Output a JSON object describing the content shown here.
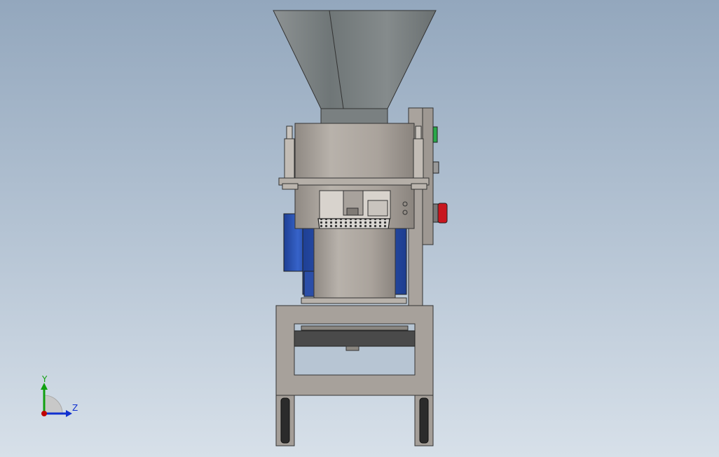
{
  "viewport": {
    "background_top": "#93a7bd",
    "background_bottom": "#d7e0e9"
  },
  "model": {
    "hopper_color": "#7d8486",
    "steel_color": "#a8a29c",
    "motor_color": "#2f56b8",
    "green_button_color": "#2aa84a",
    "red_button_color": "#c8161e"
  },
  "triad": {
    "x_axis_color": "#c00000",
    "y_axis_color": "#10a010",
    "z_axis_color": "#1030d0",
    "y_label": "Y",
    "z_label": "Z"
  }
}
